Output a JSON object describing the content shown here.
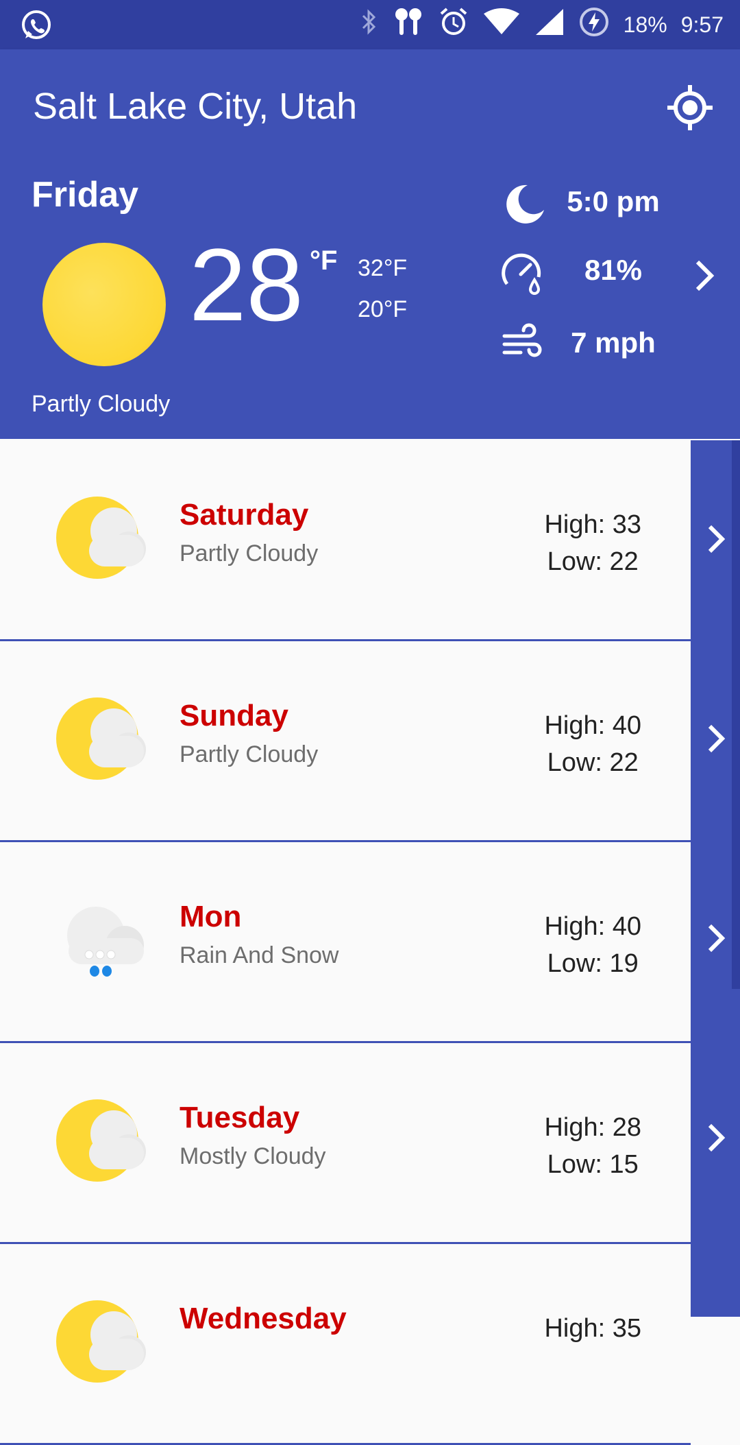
{
  "status_bar": {
    "battery": "18%",
    "time": "9:57"
  },
  "app_bar": {
    "title": "Salt Lake City, Utah"
  },
  "current": {
    "day": "Friday",
    "temp": "28",
    "unit": "°F",
    "high": "32°F",
    "low": "20°F",
    "condition": "Partly Cloudy",
    "sunset_time": "5:0 pm",
    "humidity": "81%",
    "wind": "7 mph"
  },
  "forecast": [
    {
      "day": "Saturday",
      "condition": "Partly Cloudy",
      "high": "High: 33",
      "low": "Low: 22",
      "icon": "partly-cloudy-icon"
    },
    {
      "day": "Sunday",
      "condition": "Partly Cloudy",
      "high": "High: 40",
      "low": "Low: 22",
      "icon": "partly-cloudy-icon"
    },
    {
      "day": "Mon",
      "condition": "Rain And Snow",
      "high": "High: 40",
      "low": "Low: 19",
      "icon": "rain-snow-icon"
    },
    {
      "day": "Tuesday",
      "condition": "Mostly Cloudy",
      "high": "High: 28",
      "low": "Low: 15",
      "icon": "partly-cloudy-icon"
    },
    {
      "day": "Wednesday",
      "condition": "",
      "high": "High: 35",
      "low": "",
      "icon": "partly-cloudy-icon"
    }
  ],
  "colors": {
    "primary": "#3f51b5",
    "primary_dark": "#303f9f",
    "day_name": "#cc0000",
    "sun": "#fdd835"
  }
}
